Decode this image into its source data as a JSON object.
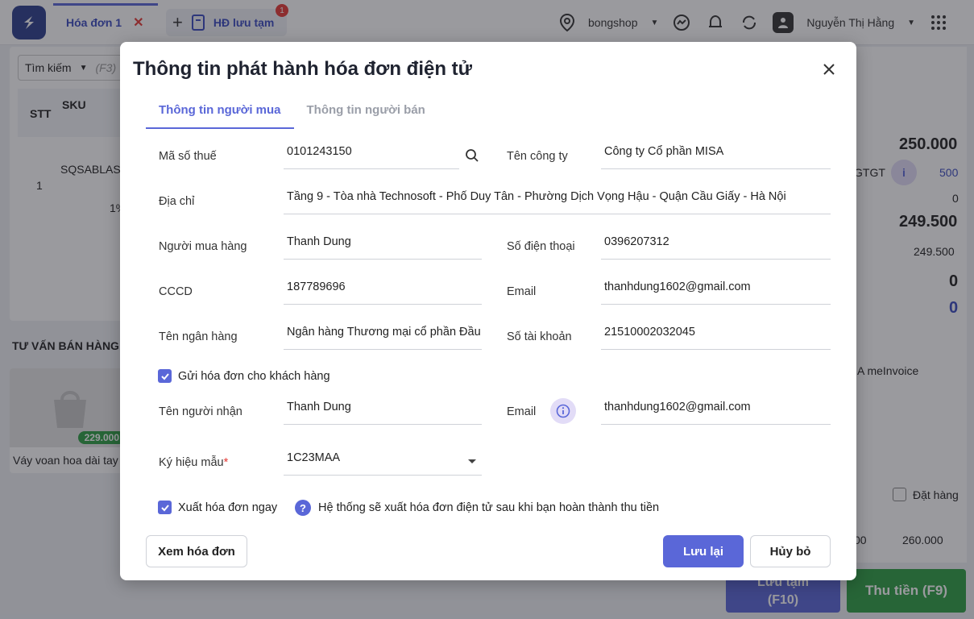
{
  "app": {
    "tabs": [
      {
        "label": "Hóa đơn 1"
      },
      {
        "label": "HĐ lưu tạm",
        "badge": "1"
      }
    ],
    "shop": "bongshop",
    "user": "Nguyễn Thị Hằng",
    "search": {
      "label": "Tìm kiếm",
      "hint": "(F3)"
    },
    "grid_headers": [
      "STT",
      "SKU"
    ],
    "row": {
      "stt": "1",
      "sku": "SQSABLASM",
      "discount": "1%"
    },
    "advise_title": "TƯ VẤN BÁN HÀNG",
    "product": {
      "name": "Váy voan hoa dài tay",
      "price": "229.000"
    },
    "summary": {
      "total": "250.000",
      "vat_label": "GTGT",
      "vat_value": "500",
      "zero1": "0",
      "after": "249.500",
      "paid": "249.500",
      "bold_zero1": "0",
      "bold_zero2": "0",
      "provider": "A meInvoice"
    },
    "order_label": "Đặt hàng",
    "quick_amounts": [
      "00",
      "260.000"
    ],
    "save_temp": "Lưu tạm",
    "save_temp_key": "(F10)",
    "pay": "Thu tiền (F9)"
  },
  "modal": {
    "title": "Thông tin phát hành hóa đơn điện tử",
    "tabs": [
      "Thông tin người mua",
      "Thông tin người bán"
    ],
    "fields": {
      "tax_code": {
        "label": "Mã số thuế",
        "value": "0101243150"
      },
      "company": {
        "label": "Tên công ty",
        "value": "Công ty Cổ phần MISA"
      },
      "address": {
        "label": "Địa chỉ",
        "value": "Tầng 9 - Tòa nhà Technosoft - Phố Duy Tân - Phường Dịch Vọng Hậu - Quận Cầu Giấy - Hà Nội"
      },
      "buyer": {
        "label": "Người mua hàng",
        "value": "Thanh Dung"
      },
      "phone": {
        "label": "Số điện thoại",
        "value": "0396207312"
      },
      "id_card": {
        "label": "CCCD",
        "value": "187789696"
      },
      "email": {
        "label": "Email",
        "value": "thanhdung1602@gmail.com"
      },
      "bank": {
        "label": "Tên ngân hàng",
        "value": "Ngân hàng Thương mại cổ phần Đầu"
      },
      "account": {
        "label": "Số tài khoản",
        "value": "21510002032045"
      },
      "recipient": {
        "label": "Tên người nhận",
        "value": "Thanh Dung"
      },
      "recipient_email": {
        "label": "Email",
        "value": "thanhdung1602@gmail.com"
      },
      "template": {
        "label": "Ký hiệu mẫu",
        "required": "*",
        "value": "1C23MAA"
      }
    },
    "send_invoice": {
      "label": "Gửi hóa đơn cho khách hàng",
      "checked": true
    },
    "issue_now": {
      "label": "Xuất hóa đơn ngay",
      "checked": true
    },
    "help_text": "Hệ thống sẽ xuất hóa đơn điện tử sau khi bạn hoàn thành thu tiền",
    "buttons": {
      "view": "Xem hóa đơn",
      "save": "Lưu lại",
      "cancel": "Hủy bỏ"
    }
  },
  "colors": {
    "accent": "#5a67d8",
    "success": "#2e9e44",
    "danger": "#e53935"
  }
}
